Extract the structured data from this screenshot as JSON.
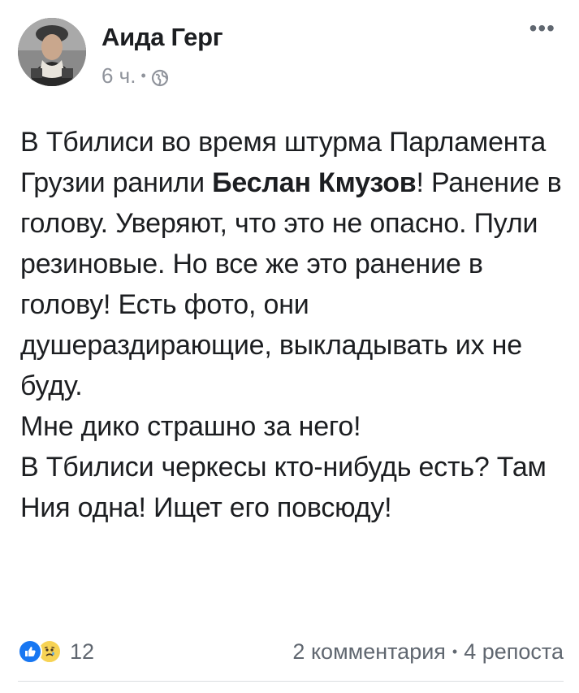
{
  "post": {
    "author": "Аида Герг",
    "time": "6 ч.",
    "meta_separator": "•",
    "privacy_icon": "globe-icon",
    "more_label": "•••",
    "body": {
      "line1": "В Тбилиси во время штурма Парламента Грузии ранили ",
      "bold_name": "Беслан Кмузов",
      "line1_rest": "! Ранение в голову. Уверяют, что это не опасно. Пули резиновые. Но все же это ранение в голову! Есть фото, они душераздирающие, выкладывать их не буду.",
      "line2": "Мне дико страшно за него!",
      "line3": "В Тбилиси черкесы кто-нибудь есть? Там Ния одна! Ищет его повсюду!"
    },
    "reactions": {
      "icons": [
        "like-icon",
        "sad-icon"
      ],
      "count": "12"
    },
    "stats": {
      "comments": "2 комментария",
      "separator": "•",
      "shares": "4 репоста"
    }
  },
  "colors": {
    "text": "#1c1e21",
    "secondary": "#606770",
    "meta": "#90949c",
    "like_blue": "#1877f2",
    "sad_yellow": "#f7d354"
  }
}
